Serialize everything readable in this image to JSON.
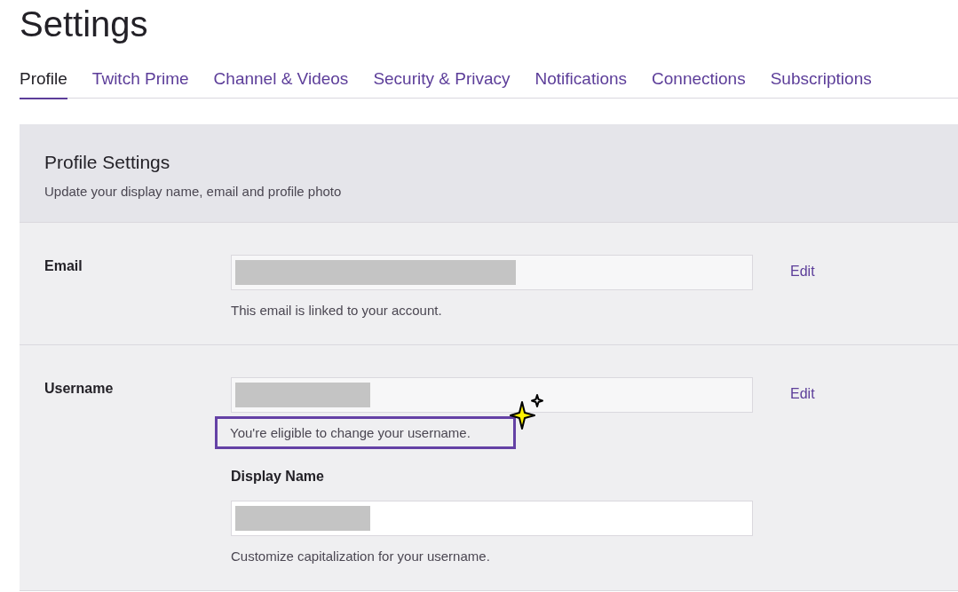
{
  "page": {
    "title": "Settings"
  },
  "tabs": [
    {
      "label": "Profile",
      "selected": true
    },
    {
      "label": "Twitch Prime",
      "selected": false
    },
    {
      "label": "Channel & Videos",
      "selected": false
    },
    {
      "label": "Security & Privacy",
      "selected": false
    },
    {
      "label": "Notifications",
      "selected": false
    },
    {
      "label": "Connections",
      "selected": false
    },
    {
      "label": "Subscriptions",
      "selected": false
    }
  ],
  "section": {
    "title": "Profile Settings",
    "subtitle": "Update your display name, email and profile photo"
  },
  "rows": [
    {
      "label": "Email",
      "fields": [
        {
          "readonly": true,
          "hint": "This email is linked to your account.",
          "highlighted": false
        }
      ],
      "action": "Edit"
    },
    {
      "label": "Username",
      "fields": [
        {
          "readonly": true,
          "hint": "You're eligible to change your username.",
          "highlighted": true
        },
        {
          "sublabel": "Display Name",
          "readonly": false,
          "hint": "Customize capitalization for your username.",
          "highlighted": false
        }
      ],
      "action": "Edit"
    }
  ]
}
